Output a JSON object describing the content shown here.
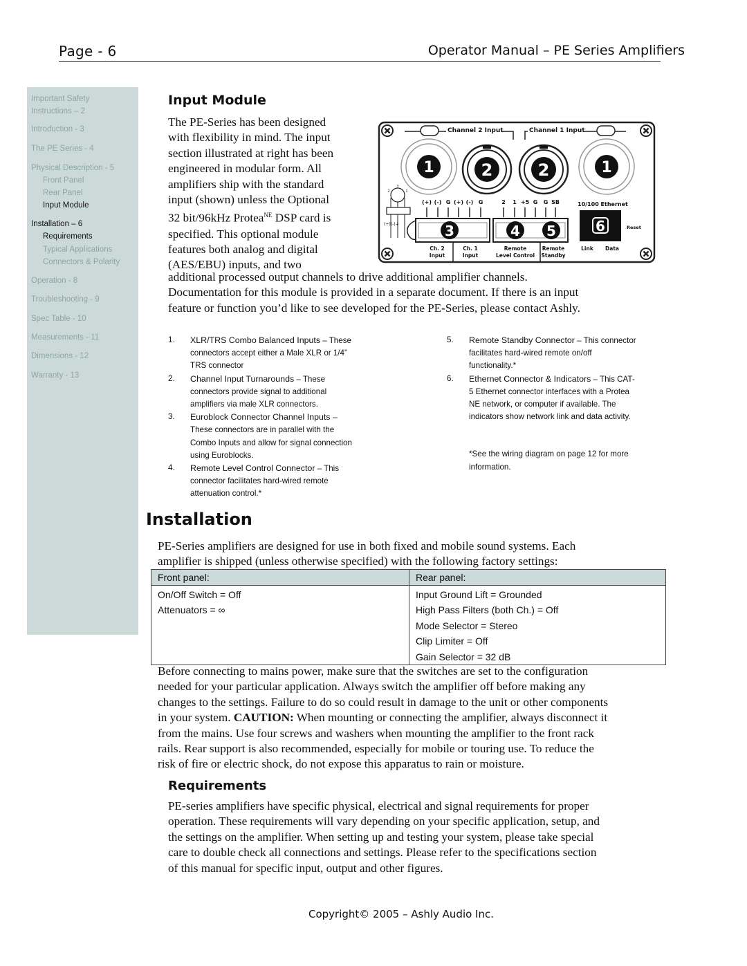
{
  "header": {
    "page_label": "Page - 6",
    "manual_title": "Operator Manual – PE Series Amplifiers"
  },
  "sidebar": {
    "items": [
      {
        "label": "Important Safety",
        "level": 1,
        "active": false
      },
      {
        "label": "Instructions – 2",
        "level": 1,
        "active": false
      },
      {
        "label": "Introduction - 3",
        "level": 1,
        "active": false
      },
      {
        "label": "The PE Series - 4",
        "level": 1,
        "active": false
      },
      {
        "label": "Physical Description - 5",
        "level": 1,
        "active": false
      },
      {
        "label": "Front Panel",
        "level": 2,
        "active": false
      },
      {
        "label": "Rear Panel",
        "level": 2,
        "active": false
      },
      {
        "label": "Input Module",
        "level": 2,
        "active": true
      },
      {
        "label": "Installation – 6",
        "level": 1,
        "active": true
      },
      {
        "label": "Requirements",
        "level": 2,
        "active": true
      },
      {
        "label": "Typical Applications",
        "level": 2,
        "active": false
      },
      {
        "label": "Connectors & Polarity",
        "level": 2,
        "active": false
      },
      {
        "label": "Operation - 8",
        "level": 1,
        "active": false
      },
      {
        "label": "Troubleshooting - 9",
        "level": 1,
        "active": false
      },
      {
        "label": "Spec Table - 10",
        "level": 1,
        "active": false
      },
      {
        "label": "Measurements - 11",
        "level": 1,
        "active": false
      },
      {
        "label": "Dimensions - 12",
        "level": 1,
        "active": false
      },
      {
        "label": "Warranty - 13",
        "level": 1,
        "active": false
      }
    ],
    "colors": {
      "background": "#cbd9d9",
      "inactive_text": "#8fa6a6",
      "active_text": "#111111"
    }
  },
  "input_module": {
    "heading": "Input Module",
    "intro_lines": [
      "The PE-Series has been designed",
      "with flexibility in mind.  The input",
      "section illustrated at right has been",
      "engineered in modular form.  All",
      "amplifiers ship with the standard",
      "input (shown) unless the Optional"
    ],
    "protea_line_pre": "32 bit/96kHz Protea",
    "protea_sup": "NE",
    "protea_line_post": " DSP card is",
    "intro_lines_2": [
      "specified. This optional module",
      "features both analog and digital",
      "(AES/EBU) inputs, and two"
    ],
    "continuation_lines": [
      "additional processed output channels to drive additional amplifier channels.",
      "Documentation for this module is provided in a separate document.  If there is an input",
      "feature or function you’d like to see developed for the PE-Series, please contact Ashly."
    ],
    "diagram": {
      "channel2_label": "Channel 2 Input",
      "channel1_label": "Channel 1 Input",
      "callouts": [
        "1",
        "2",
        "2",
        "1",
        "3",
        "4",
        "5",
        "6"
      ],
      "trs_pin_labels": [
        "3",
        "2",
        "1"
      ],
      "trs_polarity": "(+)(-)⏚",
      "pins_ch2": [
        "(+)",
        "(-)",
        "G"
      ],
      "pins_ch1": [
        "(+)",
        "(-)",
        "G"
      ],
      "pins_remote": [
        "2",
        "1",
        "+5",
        "G"
      ],
      "pins_standby": [
        "G",
        "SB"
      ],
      "ethernet_label": "10/100 Ethernet",
      "reset_label": "Reset",
      "bottom_labels": {
        "ch2": [
          "Ch. 2",
          "Input"
        ],
        "ch1": [
          "Ch. 1",
          "Input"
        ],
        "remote": [
          "Remote",
          "Level Control"
        ],
        "standby": [
          "Remote",
          "Standby"
        ],
        "link": "Link",
        "data": "Data"
      }
    },
    "list_left": [
      {
        "num": "1.",
        "lead": "XLR/TRS Combo Balanced Inputs",
        "lines": [
          " – These",
          "connectors accept either a Male XLR or 1/4”",
          "TRS connector"
        ]
      },
      {
        "num": "2.",
        "lead": "Channel Input Turnarounds",
        "lines": [
          " – These",
          "connectors provide signal to additional",
          "amplifiers via male XLR connectors."
        ]
      },
      {
        "num": "3.",
        "lead": "Euroblock Connector Channel Inputs –",
        "lines": [
          "",
          "These connectors are in parallel with the",
          "Combo Inputs and allow for signal connection",
          "using Euroblocks."
        ]
      },
      {
        "num": "4.",
        "lead": "Remote Level Control Connector",
        "lines": [
          " – This",
          "connector facilitates hard-wired remote",
          "attenuation control.*"
        ]
      }
    ],
    "list_right": [
      {
        "num": "5.",
        "lead": "Remote Standby Connector",
        "lines": [
          " – This connector",
          "facilitates hard-wired remote on/off",
          "functionality.*"
        ]
      },
      {
        "num": "6.",
        "lead": "Ethernet Connector & Indicators",
        "lines": [
          " – This CAT-",
          "5 Ethernet connector interfaces with a Protea",
          "NE network, or computer if available.  The",
          "indicators show network link and data activity."
        ]
      }
    ],
    "footnote_lines": [
      "*See the wiring diagram on page 12 for more",
      "information."
    ]
  },
  "installation": {
    "heading": "Installation",
    "intro_lines": [
      "PE-Series amplifiers are designed for use in both fixed and mobile sound systems.  Each",
      "amplifier is shipped (unless otherwise specified) with the following factory settings:"
    ],
    "table": {
      "headers": [
        "Front panel:",
        "Rear panel:"
      ],
      "front": [
        "On/Off Switch = Off",
        "Attenuators = ∞"
      ],
      "rear": [
        "Input Ground Lift = Grounded",
        "High Pass Filters (both Ch.) = Off",
        "Mode Selector = Stereo",
        "Clip Limiter = Off",
        "Gain Selector = 32 dB"
      ]
    },
    "para_lines_a": [
      "Before connecting to mains power, make sure that the switches are set to the configuration",
      "needed for your particular application. Always switch the amplifier off before making any",
      "changes to the settings.  Failure to do so could result in damage to the unit or other components"
    ],
    "caution_pre": "in your system.  ",
    "caution_label": "CAUTION:",
    "caution_post": " When mounting or connecting the amplifier, always disconnect it",
    "para_lines_b": [
      "from the mains.  Use four screws and washers when mounting the amplifier to the front rack",
      "rails.  Rear support is also recommended, especially for mobile or touring use. To reduce the",
      "risk of fire or electric shock, do not expose this apparatus to rain or moisture."
    ]
  },
  "requirements": {
    "heading": "Requirements",
    "lines": [
      "PE-series amplifiers have specific physical, electrical and signal requirements for proper",
      "operation.  These requirements will vary depending on your specific application, setup, and",
      "the settings on the amplifier.  When setting up and testing your system, please take special",
      "care to double check all connections and settings.  Please refer to the specifications section",
      "of this manual for specific input, output and other figures."
    ]
  },
  "footer": {
    "copyright": "Copyright© 2005 – Ashly Audio Inc."
  }
}
